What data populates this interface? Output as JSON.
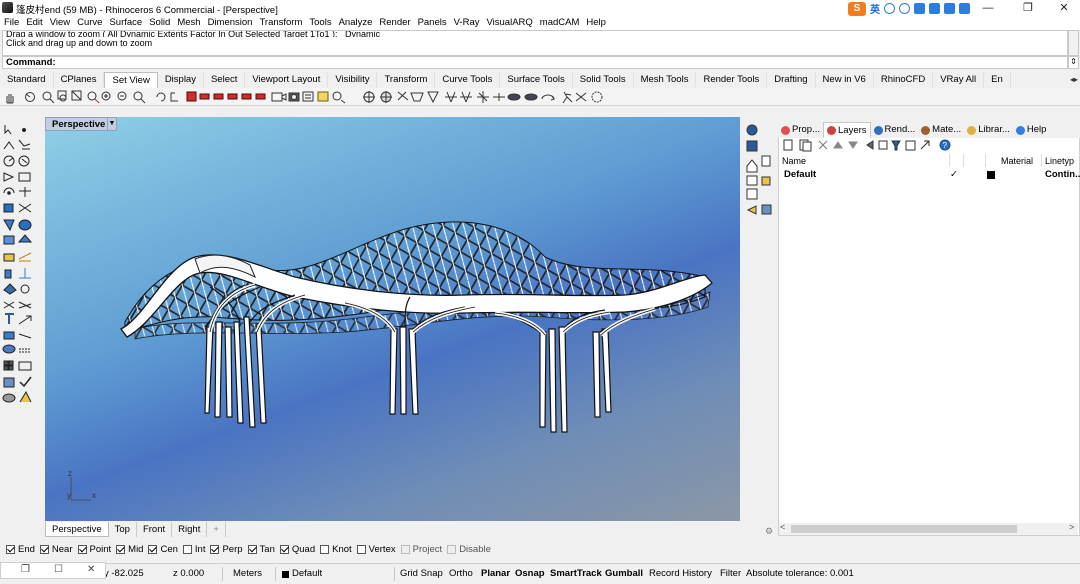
{
  "window": {
    "title": "篷皮村end (59 MB) - Rhinoceros 6 Commercial - [Perspective]",
    "controls": {
      "minimize": "—",
      "maximize": "❐",
      "close": "✕"
    }
  },
  "ime": {
    "lang": "英"
  },
  "menu": [
    "File",
    "Edit",
    "View",
    "Curve",
    "Surface",
    "Solid",
    "Mesh",
    "Dimension",
    "Transform",
    "Tools",
    "Analyze",
    "Render",
    "Panels",
    "V-Ray",
    "VisualARQ",
    "madCAM",
    "Help"
  ],
  "command": {
    "history_1": "Drag a window to zoom ( All  Dynamic  Extents  Factor  In  Out  Selected  Target  1To1 ): _Dynamic",
    "history_2": "Click and drag up and down to zoom",
    "prompt": "Command:"
  },
  "toolbar_tabs": [
    "Standard",
    "CPlanes",
    "Set View",
    "Display",
    "Select",
    "Viewport Layout",
    "Visibility",
    "Transform",
    "Curve Tools",
    "Surface Tools",
    "Solid Tools",
    "Mesh Tools",
    "Render Tools",
    "Drafting",
    "New in V6",
    "RhinoCFD",
    "VRay All",
    "En"
  ],
  "active_toolbar_tab": "Set View",
  "viewport": {
    "label": "Perspective",
    "axis_z": "z",
    "axis_y": "y",
    "axis_x": "x"
  },
  "viewport_tabs": [
    "Perspective",
    "Top",
    "Front",
    "Right"
  ],
  "viewport_tab_add": "+",
  "panel_tabs": [
    {
      "label": "Prop...",
      "icon": "properties-icon",
      "color": "#e05050"
    },
    {
      "label": "Layers",
      "icon": "layers-icon",
      "color": "#d04040"
    },
    {
      "label": "Rend...",
      "icon": "render-icon",
      "color": "#3070c0"
    },
    {
      "label": "Mate...",
      "icon": "material-icon",
      "color": "#a06030"
    },
    {
      "label": "Librar...",
      "icon": "library-icon",
      "color": "#e0b040"
    },
    {
      "label": "Help",
      "icon": "help-icon",
      "color": "#3080e0"
    }
  ],
  "active_panel_tab": "Layers",
  "layers": {
    "columns": {
      "name": "Name",
      "material": "Material",
      "linetype": "Linetyp"
    },
    "rows": [
      {
        "name": "Default",
        "current": "✓",
        "linetype": "Contin..."
      }
    ]
  },
  "osnap": [
    {
      "label": "End",
      "checked": true
    },
    {
      "label": "Near",
      "checked": true
    },
    {
      "label": "Point",
      "checked": true
    },
    {
      "label": "Mid",
      "checked": true
    },
    {
      "label": "Cen",
      "checked": true
    },
    {
      "label": "Int",
      "checked": false
    },
    {
      "label": "Perp",
      "checked": true
    },
    {
      "label": "Tan",
      "checked": true
    },
    {
      "label": "Quad",
      "checked": true
    },
    {
      "label": "Knot",
      "checked": false
    },
    {
      "label": "Vertex",
      "checked": false
    },
    {
      "label": "Project",
      "checked": false,
      "disabled": true
    },
    {
      "label": "Disable",
      "checked": false,
      "disabled": true
    }
  ],
  "status": {
    "coord_y": "y -82.025",
    "coord_z": "z 0.000",
    "units": "Meters",
    "layer": "Default",
    "grid_snap": "Grid Snap",
    "ortho": "Ortho",
    "planar": "Planar",
    "osnap": "Osnap",
    "smarttrack": "SmartTrack",
    "gumball": "Gumball",
    "record_history": "Record History",
    "filter": "Filter",
    "tolerance": "Absolute tolerance: 0.001"
  }
}
